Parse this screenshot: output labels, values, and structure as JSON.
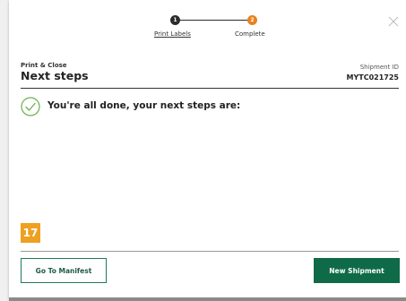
{
  "stepper": {
    "steps": [
      {
        "number": "1",
        "label": "Print Labels"
      },
      {
        "number": "2",
        "label": "Complete"
      }
    ]
  },
  "header": {
    "subtitle": "Print & Close",
    "title": "Next steps",
    "shipment_label": "Shipment ID",
    "shipment_id": "MYTC021725"
  },
  "body": {
    "done_message": "You're all done, your next steps are:"
  },
  "badge": {
    "text": "17"
  },
  "footer": {
    "manifest_button": "Go To Manifest",
    "new_shipment_button": "New Shipment"
  },
  "colors": {
    "accent_green": "#0f6b47",
    "step_active": "#e8821e",
    "badge": "#f0a020",
    "check": "#6ab04c"
  },
  "icons": {
    "close": "close-icon",
    "check": "check-circle-icon"
  }
}
